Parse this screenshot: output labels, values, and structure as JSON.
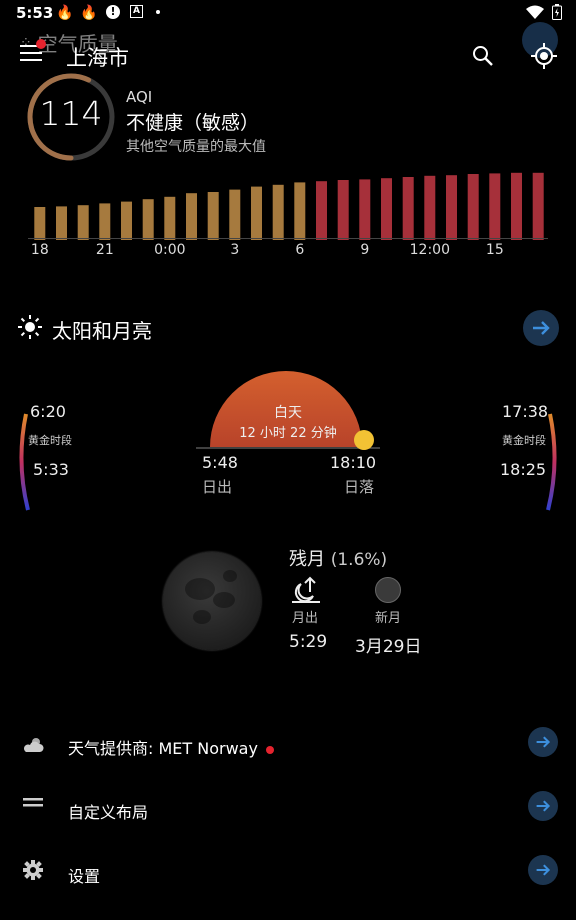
{
  "status_bar": {
    "time": "5:53",
    "icons": [
      "fire-icon",
      "fire-icon",
      "alert-icon",
      "a-icon",
      "dot-icon"
    ],
    "right_icons": [
      "wifi-icon",
      "battery-icon"
    ]
  },
  "top_bar": {
    "behind_title": "空气质量",
    "city": "上海市"
  },
  "aqi": {
    "value": "114",
    "label": "AQI",
    "status": "不健康（敏感）",
    "description": "其他空气质量的最大值",
    "progress_fraction": 0.57,
    "ring_color": "#a0704a"
  },
  "aqi_chart": {
    "type": "bar",
    "values": [
      95,
      96,
      98,
      101,
      104,
      108,
      112,
      118,
      120,
      124,
      129,
      132,
      136,
      138,
      140,
      141,
      143,
      145,
      147,
      148,
      150,
      151,
      152,
      152
    ],
    "colors": [
      "#a67a3e",
      "#a67a3e",
      "#a67a3e",
      "#a67a3e",
      "#a67a3e",
      "#a67a3e",
      "#a67a3e",
      "#a67a3e",
      "#a67a3e",
      "#a67a3e",
      "#a67a3e",
      "#a67a3e",
      "#a67a3e",
      "#a6303a",
      "#a6303a",
      "#a6303a",
      "#a6303a",
      "#a6303a",
      "#a6303a",
      "#a6303a",
      "#a6303a",
      "#a6303a",
      "#a6303a",
      "#a6303a"
    ],
    "tick_labels": [
      "18",
      "21",
      "0:00",
      "3",
      "6",
      "9",
      "12:00",
      "15"
    ]
  },
  "sun_moon": {
    "title": "太阳和月亮",
    "golden_left_top": "6:20",
    "golden_left_label": "黄金时段",
    "golden_left_bottom": "5:33",
    "golden_right_top": "17:38",
    "golden_right_label": "黄金时段",
    "golden_right_bottom": "18:25",
    "daytime_label": "白天",
    "daytime_duration": "12 小时 22 分钟",
    "sunrise_time": "5:48",
    "sunrise_label": "日出",
    "sunset_time": "18:10",
    "sunset_label": "日落",
    "moon_phase": "残月",
    "moon_illumination": "(1.6%)",
    "moonrise_label": "月出",
    "moonrise_time": "5:29",
    "new_moon_label": "新月",
    "new_moon_date": "3月29日"
  },
  "menu": {
    "provider": "天气提供商: MET Norway",
    "custom_layout": "自定义布局",
    "settings": "设置"
  },
  "colors": {
    "accent": "#3d8fdd",
    "arrow_bg": "#1c3550",
    "sun_arc": "#c9502c",
    "alert_dot": "#e5232e"
  }
}
